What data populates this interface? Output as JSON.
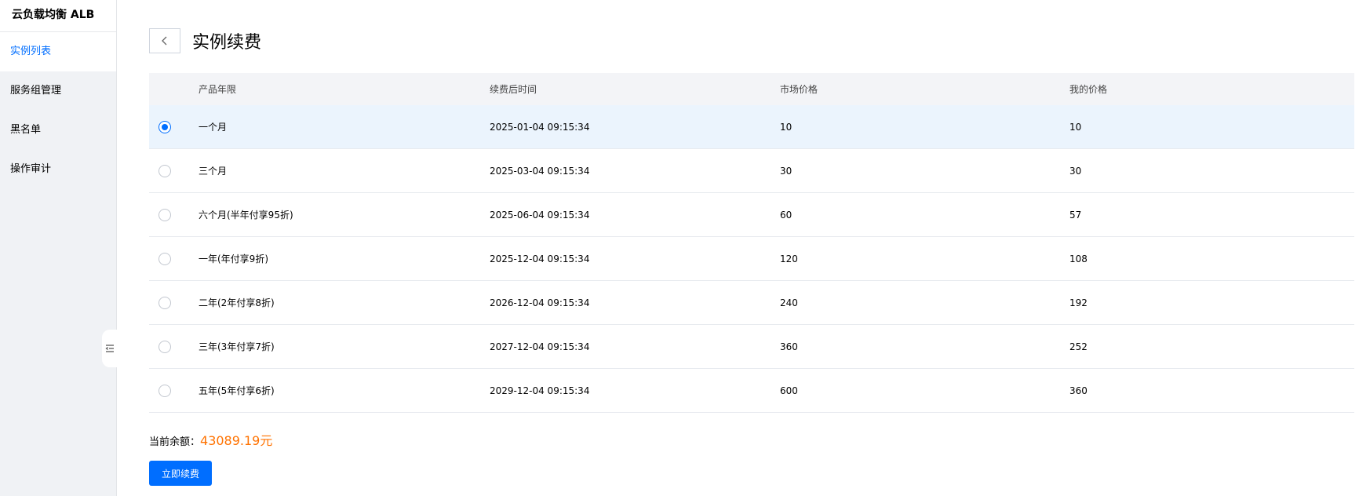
{
  "sidebar": {
    "title": "云负载均衡 ALB",
    "items": [
      {
        "label": "实例列表",
        "active": true
      },
      {
        "label": "服务组管理",
        "active": false
      },
      {
        "label": "黑名单",
        "active": false
      },
      {
        "label": "操作审计",
        "active": false
      }
    ]
  },
  "page": {
    "title": "实例续费"
  },
  "table": {
    "headers": [
      "产品年限",
      "续费后时间",
      "市场价格",
      "我的价格"
    ],
    "rows": [
      {
        "period": "一个月",
        "expire": "2025-01-04 09:15:34",
        "market_price": "10",
        "my_price": "10",
        "selected": true
      },
      {
        "period": "三个月",
        "expire": "2025-03-04 09:15:34",
        "market_price": "30",
        "my_price": "30",
        "selected": false
      },
      {
        "period": "六个月(半年付享95折)",
        "expire": "2025-06-04 09:15:34",
        "market_price": "60",
        "my_price": "57",
        "selected": false
      },
      {
        "period": "一年(年付享9折)",
        "expire": "2025-12-04 09:15:34",
        "market_price": "120",
        "my_price": "108",
        "selected": false
      },
      {
        "period": "二年(2年付享8折)",
        "expire": "2026-12-04 09:15:34",
        "market_price": "240",
        "my_price": "192",
        "selected": false
      },
      {
        "period": "三年(3年付享7折)",
        "expire": "2027-12-04 09:15:34",
        "market_price": "360",
        "my_price": "252",
        "selected": false
      },
      {
        "period": "五年(5年付享6折)",
        "expire": "2029-12-04 09:15:34",
        "market_price": "600",
        "my_price": "360",
        "selected": false
      }
    ]
  },
  "balance": {
    "label": "当前余额：",
    "value": "43089.19元"
  },
  "actions": {
    "renew_label": "立即续费"
  },
  "colors": {
    "accent": "#006eff",
    "balance": "#ff7200",
    "selected_row": "#ebf4fd"
  }
}
